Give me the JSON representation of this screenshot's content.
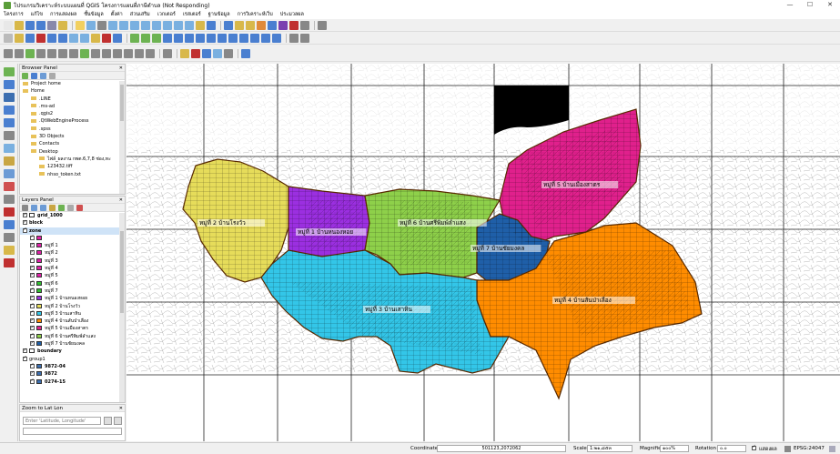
{
  "window": {
    "title": "โปรแกรมวิเคราะห์ระบบแผนที่ QGIS โครงการแผนที่ภาษีตำบล (Not Responding)"
  },
  "menu": [
    "โครงการ",
    "แก้ไข",
    "การแสดงผล",
    "ชั้นข้อมูล",
    "ตั้งค่า",
    "ส่วนเสริม",
    "เวกเตอร์",
    "เรสเตอร์",
    "ฐานข้อมูล",
    "การวิเคราะห์เว็บ",
    "ประมวลผล"
  ],
  "browser": {
    "title": "Browser Panel",
    "items": [
      {
        "label": "Project home",
        "indent": 0
      },
      {
        "label": "Home",
        "indent": 0
      },
      {
        "label": ".LINE",
        "indent": 1
      },
      {
        "label": ".ms-ad",
        "indent": 1
      },
      {
        "label": ".qgis2",
        "indent": 1
      },
      {
        "label": ".QtWebEngineProcess",
        "indent": 1
      },
      {
        "label": ".spss",
        "indent": 1
      },
      {
        "label": "3D Objects",
        "indent": 1
      },
      {
        "label": "Contacts",
        "indent": 1
      },
      {
        "label": "Desktop",
        "indent": 1
      },
      {
        "label": "ไฟล์_ผลงาน กพต.6,7,8 ช่อง,ทะ",
        "indent": 2
      },
      {
        "label": "123432.tiff",
        "indent": 2
      },
      {
        "label": "nhso_token.txt",
        "indent": 2
      }
    ]
  },
  "layers": {
    "title": "Layers Panel",
    "items": [
      {
        "label": "grid_1000",
        "indent": 0,
        "swatch": "#ffffff",
        "bold": true
      },
      {
        "label": "block",
        "indent": 0,
        "swatch": "",
        "bold": true
      },
      {
        "label": "zone",
        "indent": 0,
        "swatch": "",
        "bold": true,
        "selected": true
      },
      {
        "label": "",
        "indent": 1,
        "swatch": "#e020a8"
      },
      {
        "label": "หมู่ที่ 1",
        "indent": 1,
        "swatch": "#e020a8"
      },
      {
        "label": "หมู่ที่ 2",
        "indent": 1,
        "swatch": "#e020a8"
      },
      {
        "label": "หมู่ที่ 3",
        "indent": 1,
        "swatch": "#e020a8"
      },
      {
        "label": "หมู่ที่ 4",
        "indent": 1,
        "swatch": "#e020a8"
      },
      {
        "label": "หมู่ที่ 5",
        "indent": 1,
        "swatch": "#e020a8"
      },
      {
        "label": "หมู่ที่ 6",
        "indent": 1,
        "swatch": "#30c030"
      },
      {
        "label": "หมู่ที่ 7",
        "indent": 1,
        "swatch": "#30c030"
      },
      {
        "label": "หมู่ที่ 1 บ้านหนองหอย",
        "indent": 1,
        "swatch": "#9b2fe0"
      },
      {
        "label": "หมู่ที่ 2 บ้านโรงวัว",
        "indent": 1,
        "swatch": "#e6dc5a"
      },
      {
        "label": "หมู่ที่ 3 บ้านเสาหิน",
        "indent": 1,
        "swatch": "#33c6e8"
      },
      {
        "label": "หมู่ที่ 4 บ้านสันป่าเลือง",
        "indent": 1,
        "swatch": "#ff8c00"
      },
      {
        "label": "หมู่ที่ 5 บ้านเมืองสาตร",
        "indent": 1,
        "swatch": "#e0208c"
      },
      {
        "label": "หมู่ที่ 6 บ้านศรีพิมพ์ลำแสง",
        "indent": 1,
        "swatch": "#8ed04a"
      },
      {
        "label": "หมู่ที่ 7 บ้านชัยมงคล",
        "indent": 1,
        "swatch": "#1f5fa8"
      },
      {
        "label": "boundary",
        "indent": 0,
        "swatch": "#ffffff",
        "bold": true
      },
      {
        "label": "group1",
        "indent": 0,
        "swatch": "",
        "bold": false
      },
      {
        "label": "9872-04",
        "indent": 1,
        "swatch": "#3d6fb0",
        "bold": true
      },
      {
        "label": "9872",
        "indent": 1,
        "swatch": "#3d6fb0",
        "bold": true
      },
      {
        "label": "0274-15",
        "indent": 1,
        "swatch": "#3d6fb0",
        "bold": true
      }
    ]
  },
  "zoom": {
    "title": "Zoom to Lat Lon",
    "placeholder": "Enter 'Latitude, Longitude'"
  },
  "map": {
    "labels": [
      "หมู่ที่ 2 บ้านโรงวัว",
      "หมู่ที่ 1 บ้านหนองหอย",
      "หมู่ที่ 6 บ้านศรีพิมพ์ลำแสง",
      "หมู่ที่ 7 บ้านชัยมงคล",
      "หมู่ที่ 5 บ้านเมืองสาตร",
      "หมู่ที่ 3 บ้านเสาหิน",
      "หมู่ที่ 4 บ้านสันป่าเลือง"
    ]
  },
  "status": {
    "coord_label": "Coordinate",
    "coord_value": "501123,2072062",
    "scale_label": "Scale",
    "scale_value": "1:๒๑,๘๕๓",
    "mag_label": "Magnifier",
    "mag_value": "๑๐๐%",
    "rot_label": "Rotation",
    "rot_value": "๐.๐",
    "render_label": "แสดงผล",
    "crs": "EPSG:24047"
  }
}
